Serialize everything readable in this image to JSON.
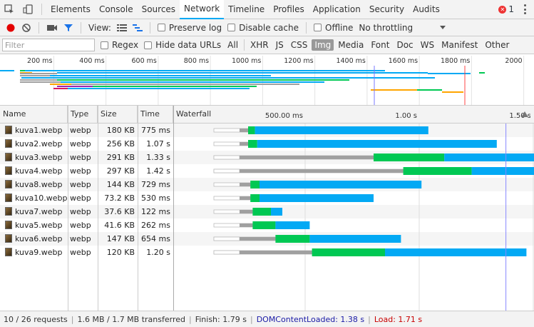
{
  "tabs": [
    "Elements",
    "Console",
    "Sources",
    "Network",
    "Timeline",
    "Profiles",
    "Application",
    "Security",
    "Audits"
  ],
  "active_tab": "Network",
  "error_count": "1",
  "toolbar": {
    "view_label": "View:",
    "preserve_log": "Preserve log",
    "disable_cache": "Disable cache",
    "offline": "Offline",
    "throttling": "No throttling"
  },
  "filter": {
    "placeholder": "Filter",
    "regex": "Regex",
    "hide_data_urls": "Hide data URLs",
    "types": [
      "All",
      "XHR",
      "JS",
      "CSS",
      "Img",
      "Media",
      "Font",
      "Doc",
      "WS",
      "Manifest",
      "Other"
    ],
    "active_type": "Img"
  },
  "overview": {
    "ticks": [
      "200 ms",
      "400 ms",
      "600 ms",
      "800 ms",
      "1000 ms",
      "1200 ms",
      "1400 ms",
      "1600 ms",
      "1800 ms",
      "2000"
    ],
    "tick_values_ms": [
      200,
      400,
      600,
      800,
      1000,
      1200,
      1400,
      1600,
      1800,
      2000
    ]
  },
  "columns": {
    "name": "Name",
    "type": "Type",
    "size": "Size",
    "time": "Time",
    "waterfall": "Waterfall"
  },
  "waterfall_ticks": [
    "500.00 ms",
    "1.00 s",
    "1.50 s"
  ],
  "waterfall_tick_values_s": [
    0.5,
    1.0,
    1.5
  ],
  "markers_s": {
    "domcontentloaded": 1.38,
    "load": 1.71
  },
  "colors": {
    "stalled": "#a0a0a0",
    "waiting": "#00c853",
    "receiving": "#03a9f4",
    "queued": "#ffffff",
    "domcontentloaded": "#0000ff",
    "load": "#ff0000",
    "record": "#e40000"
  },
  "requests": [
    {
      "name": "kuva1.webp",
      "type": "webp",
      "size": "180 KB",
      "time": "775 ms",
      "start": 0.1,
      "stall_end": 0.25,
      "ttfb_end": 0.28,
      "end": 1.04
    },
    {
      "name": "kuva2.webp",
      "type": "webp",
      "size": "256 KB",
      "time": "1.07 s",
      "start": 0.1,
      "stall_end": 0.25,
      "ttfb_end": 0.29,
      "end": 1.34
    },
    {
      "name": "kuva3.webp",
      "type": "webp",
      "size": "291 KB",
      "time": "1.33 s",
      "start": 0.1,
      "stall_end": 0.8,
      "ttfb_end": 1.11,
      "end": 1.6
    },
    {
      "name": "kuva4.webp",
      "type": "webp",
      "size": "297 KB",
      "time": "1.42 s",
      "start": 0.1,
      "stall_end": 0.93,
      "ttfb_end": 1.23,
      "end": 1.69
    },
    {
      "name": "kuva8.webp",
      "type": "webp",
      "size": "144 KB",
      "time": "729 ms",
      "start": 0.1,
      "stall_end": 0.26,
      "ttfb_end": 0.3,
      "end": 1.01
    },
    {
      "name": "kuva10.webp",
      "type": "webp",
      "size": "73.2 KB",
      "time": "530 ms",
      "start": 0.1,
      "stall_end": 0.26,
      "ttfb_end": 0.3,
      "end": 0.8
    },
    {
      "name": "kuva7.webp",
      "type": "webp",
      "size": "37.6 KB",
      "time": "122 ms",
      "start": 0.1,
      "stall_end": 0.27,
      "ttfb_end": 0.35,
      "end": 0.4
    },
    {
      "name": "kuva5.webp",
      "type": "webp",
      "size": "41.6 KB",
      "time": "262 ms",
      "start": 0.1,
      "stall_end": 0.27,
      "ttfb_end": 0.37,
      "end": 0.52
    },
    {
      "name": "kuva6.webp",
      "type": "webp",
      "size": "147 KB",
      "time": "654 ms",
      "start": 0.1,
      "stall_end": 0.37,
      "ttfb_end": 0.52,
      "end": 0.92
    },
    {
      "name": "kuva9.webp",
      "type": "webp",
      "size": "120 KB",
      "time": "1.20 s",
      "start": 0.1,
      "stall_end": 0.53,
      "ttfb_end": 0.85,
      "end": 1.47
    }
  ],
  "status": {
    "requests": "10 / 26 requests",
    "transferred": "1.6 MB / 1.7 MB transferred",
    "finish": "Finish: 1.79 s",
    "domcontentloaded": "DOMContentLoaded: 1.38 s",
    "load": "Load: 1.71 s"
  }
}
